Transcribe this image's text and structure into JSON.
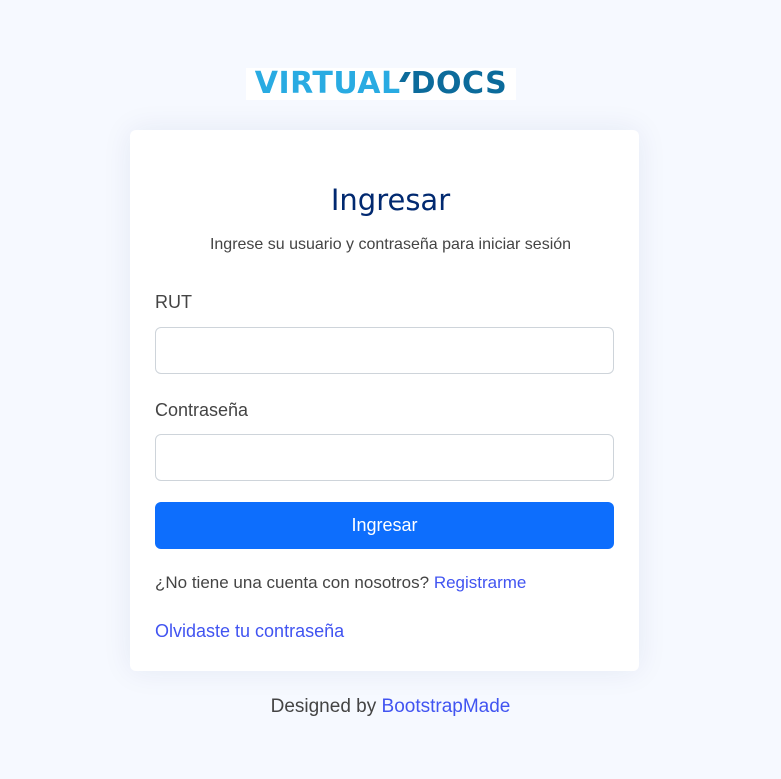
{
  "logo": {
    "part1": "VIRTUAL",
    "part2": "DOCS"
  },
  "login": {
    "title": "Ingresar",
    "subtitle": "Ingrese su usuario y contraseña para iniciar sesión",
    "rut_label": "RUT",
    "rut_value": "",
    "password_label": "Contraseña",
    "password_value": "",
    "submit_label": "Ingresar",
    "register_prompt": "¿No tiene una cuenta con nosotros?",
    "register_link": "Registrarme",
    "forgot_link": "Olvidaste tu contraseña"
  },
  "footer": {
    "designed_by": "Designed by",
    "credit_link": "BootstrapMade"
  },
  "colors": {
    "background": "#f6f9ff",
    "primary_button": "#0d6efd",
    "link": "#4154f1",
    "title": "#012970",
    "logo_light": "#29abe2",
    "logo_dark": "#0c6b9b"
  }
}
